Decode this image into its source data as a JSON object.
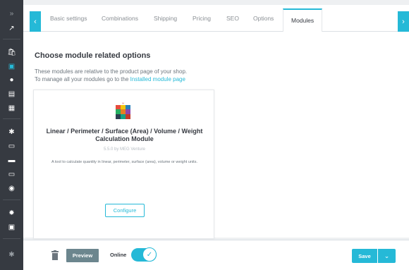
{
  "sidebar": {
    "items": [
      {
        "icon": "collapse-icon",
        "glyph": "»"
      },
      {
        "icon": "dashboard-icon",
        "glyph": "↗"
      },
      {
        "icon": "orders-icon",
        "glyph": "🛍"
      },
      {
        "icon": "catalog-icon",
        "glyph": "▣"
      },
      {
        "icon": "customers-icon",
        "glyph": "●"
      },
      {
        "icon": "messages-icon",
        "glyph": "▤"
      },
      {
        "icon": "stats-icon",
        "glyph": "▦"
      },
      {
        "icon": "modules-icon",
        "glyph": "✱"
      },
      {
        "icon": "design-icon",
        "glyph": "▭"
      },
      {
        "icon": "shipping-icon",
        "glyph": "▬"
      },
      {
        "icon": "payment-icon",
        "glyph": "▭"
      },
      {
        "icon": "international-icon",
        "glyph": "◉"
      },
      {
        "icon": "settings-icon",
        "glyph": "✹"
      },
      {
        "icon": "advanced-icon",
        "glyph": "▣"
      },
      {
        "icon": "extensions-icon",
        "glyph": "✱"
      }
    ]
  },
  "tabs": [
    {
      "label": "Basic settings"
    },
    {
      "label": "Combinations"
    },
    {
      "label": "Shipping"
    },
    {
      "label": "Pricing"
    },
    {
      "label": "SEO"
    },
    {
      "label": "Options"
    },
    {
      "label": "Modules"
    }
  ],
  "tab_arrows": {
    "left": "‹",
    "right": "›"
  },
  "main": {
    "heading": "Choose module related options",
    "desc_line1": "These modules are relative to the product page of your shop.",
    "desc_line2_prefix": "To manage all your modules go to the",
    "desc_link": "Installed module page"
  },
  "module": {
    "name": "Linear / Perimeter / Surface (Area) / Volume / Weight Calculation Module",
    "version": "5.5.0 by MEG Venture",
    "description": "A tool to calculate quantity in linear, perimeter, surface (area), volume or weight units.",
    "configure_label": "Configure"
  },
  "footer": {
    "preview_label": "Preview",
    "online_label": "Online",
    "online_enabled": true,
    "save_label": "Save",
    "save_dropdown_glyph": "⌄"
  },
  "colors": {
    "accent": "#25b9d7",
    "sidebar": "#363a41",
    "preview": "#6c868e"
  }
}
